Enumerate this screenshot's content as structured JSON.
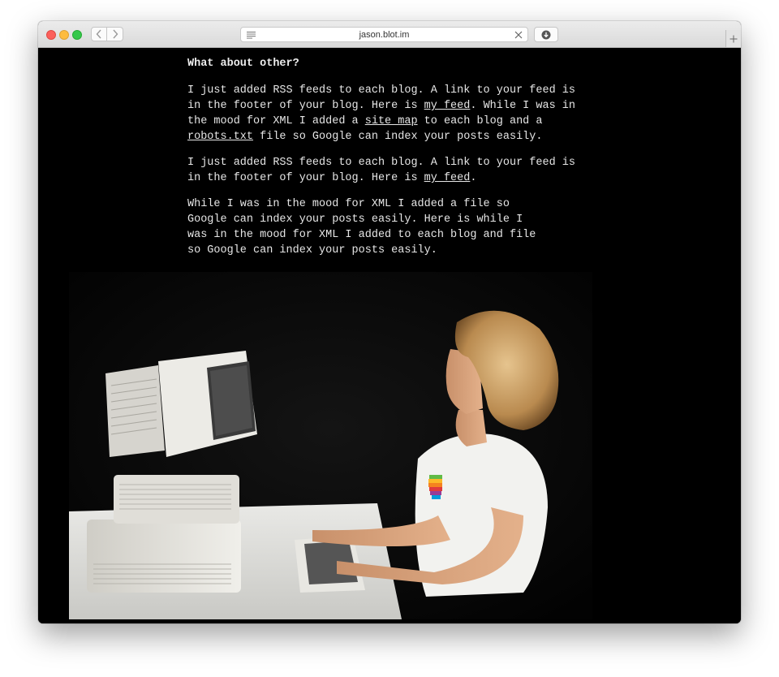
{
  "browser": {
    "url": "jason.blot.im"
  },
  "article": {
    "heading": "What about other?",
    "para1": {
      "t1": "I just added RSS feeds to each blog. A link to your feed is in the footer of your blog. Here is ",
      "link1": "my feed",
      "t2": ". While I was in the mood for XML I added a ",
      "link2": "site map",
      "t3": " to each blog and a ",
      "link3": "robots.txt",
      "t4": " file so Google can index your posts easily."
    },
    "para2": {
      "t1": "I just added RSS feeds to each blog. A link to your feed is in the footer of your blog. Here is ",
      "link1": "my feed",
      "t2": "."
    },
    "blockquote": "While I was in the mood for XML I added a file so Google can index your posts easily. Here is while I was in the mood for XML I added to each blog and file so Google can index your posts easily."
  },
  "icons": {
    "reader": "reader-icon",
    "stop": "close-icon",
    "download": "download-icon",
    "new_tab": "plus-icon"
  }
}
